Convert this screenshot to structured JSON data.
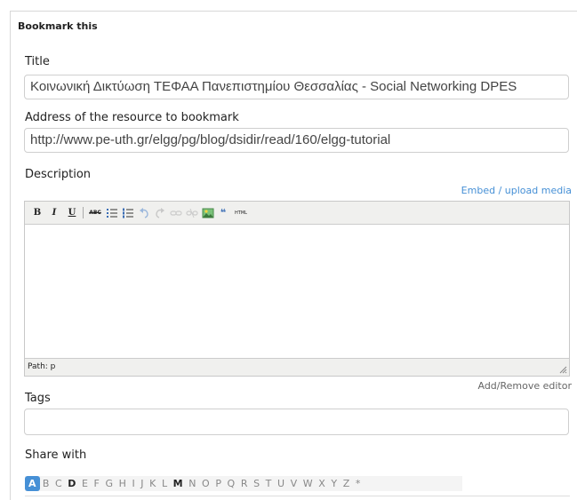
{
  "panel": {
    "title": "Bookmark this"
  },
  "title_field": {
    "label": "Title",
    "value": "Κοινωνική Δικτύωση ΤΕΦΑΑ Πανεπιστημίου Θεσσαλίας - Social Networking DPES"
  },
  "address_field": {
    "label": "Address of the resource to bookmark",
    "value": "http://www.pe-uth.gr/elgg/pg/blog/dsidir/read/160/elgg-tutorial"
  },
  "description": {
    "label": "Description",
    "embed_link": "Embed / upload media",
    "toolbar": {
      "bold": "B",
      "italic": "I",
      "underline": "U",
      "strike": "ABC",
      "html": "HTML"
    },
    "statusbar_path": "Path: p",
    "add_remove_editor": "Add/Remove editor"
  },
  "tags": {
    "label": "Tags",
    "value": ""
  },
  "share": {
    "label": "Share with",
    "letters": [
      "A",
      "B",
      "C",
      "D",
      "E",
      "F",
      "G",
      "H",
      "I",
      "J",
      "K",
      "L",
      "M",
      "N",
      "O",
      "P",
      "Q",
      "R",
      "S",
      "T",
      "U",
      "V",
      "W",
      "X",
      "Y",
      "Z",
      "*"
    ],
    "selected": "A",
    "bold_letters": [
      "D",
      "M"
    ]
  },
  "colors": {
    "accent": "#4690d6",
    "toolbar_bg": "#f0f0ee",
    "border": "#cfcfcf"
  }
}
